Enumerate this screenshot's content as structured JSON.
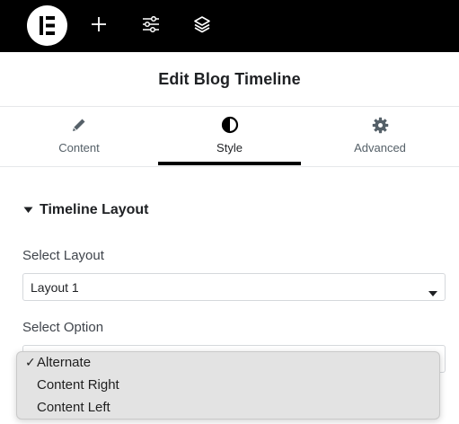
{
  "topbar": {
    "logo_icon": "elementor-logo-icon",
    "buttons": [
      {
        "icon": "plus-icon"
      },
      {
        "icon": "sliders-icon"
      },
      {
        "icon": "layers-icon"
      }
    ]
  },
  "header": {
    "title": "Edit Blog Timeline"
  },
  "tabs": [
    {
      "label": "Content",
      "icon": "pencil-icon",
      "active": false
    },
    {
      "label": "Style",
      "icon": "contrast-icon",
      "active": true
    },
    {
      "label": "Advanced",
      "icon": "gear-icon",
      "active": false
    }
  ],
  "section": {
    "title": "Timeline Layout",
    "expanded": true
  },
  "fields": {
    "layout": {
      "label": "Select Layout",
      "value": "Layout 1"
    },
    "option": {
      "label": "Select Option",
      "options": [
        "Alternate",
        "Content Right",
        "Content Left"
      ],
      "selected": "Alternate",
      "check_mark": "✓"
    }
  },
  "colors": {
    "topbar_bg": "#000000",
    "active_tab_underline": "#000000",
    "dropdown_bg": "#e3e3e3"
  }
}
